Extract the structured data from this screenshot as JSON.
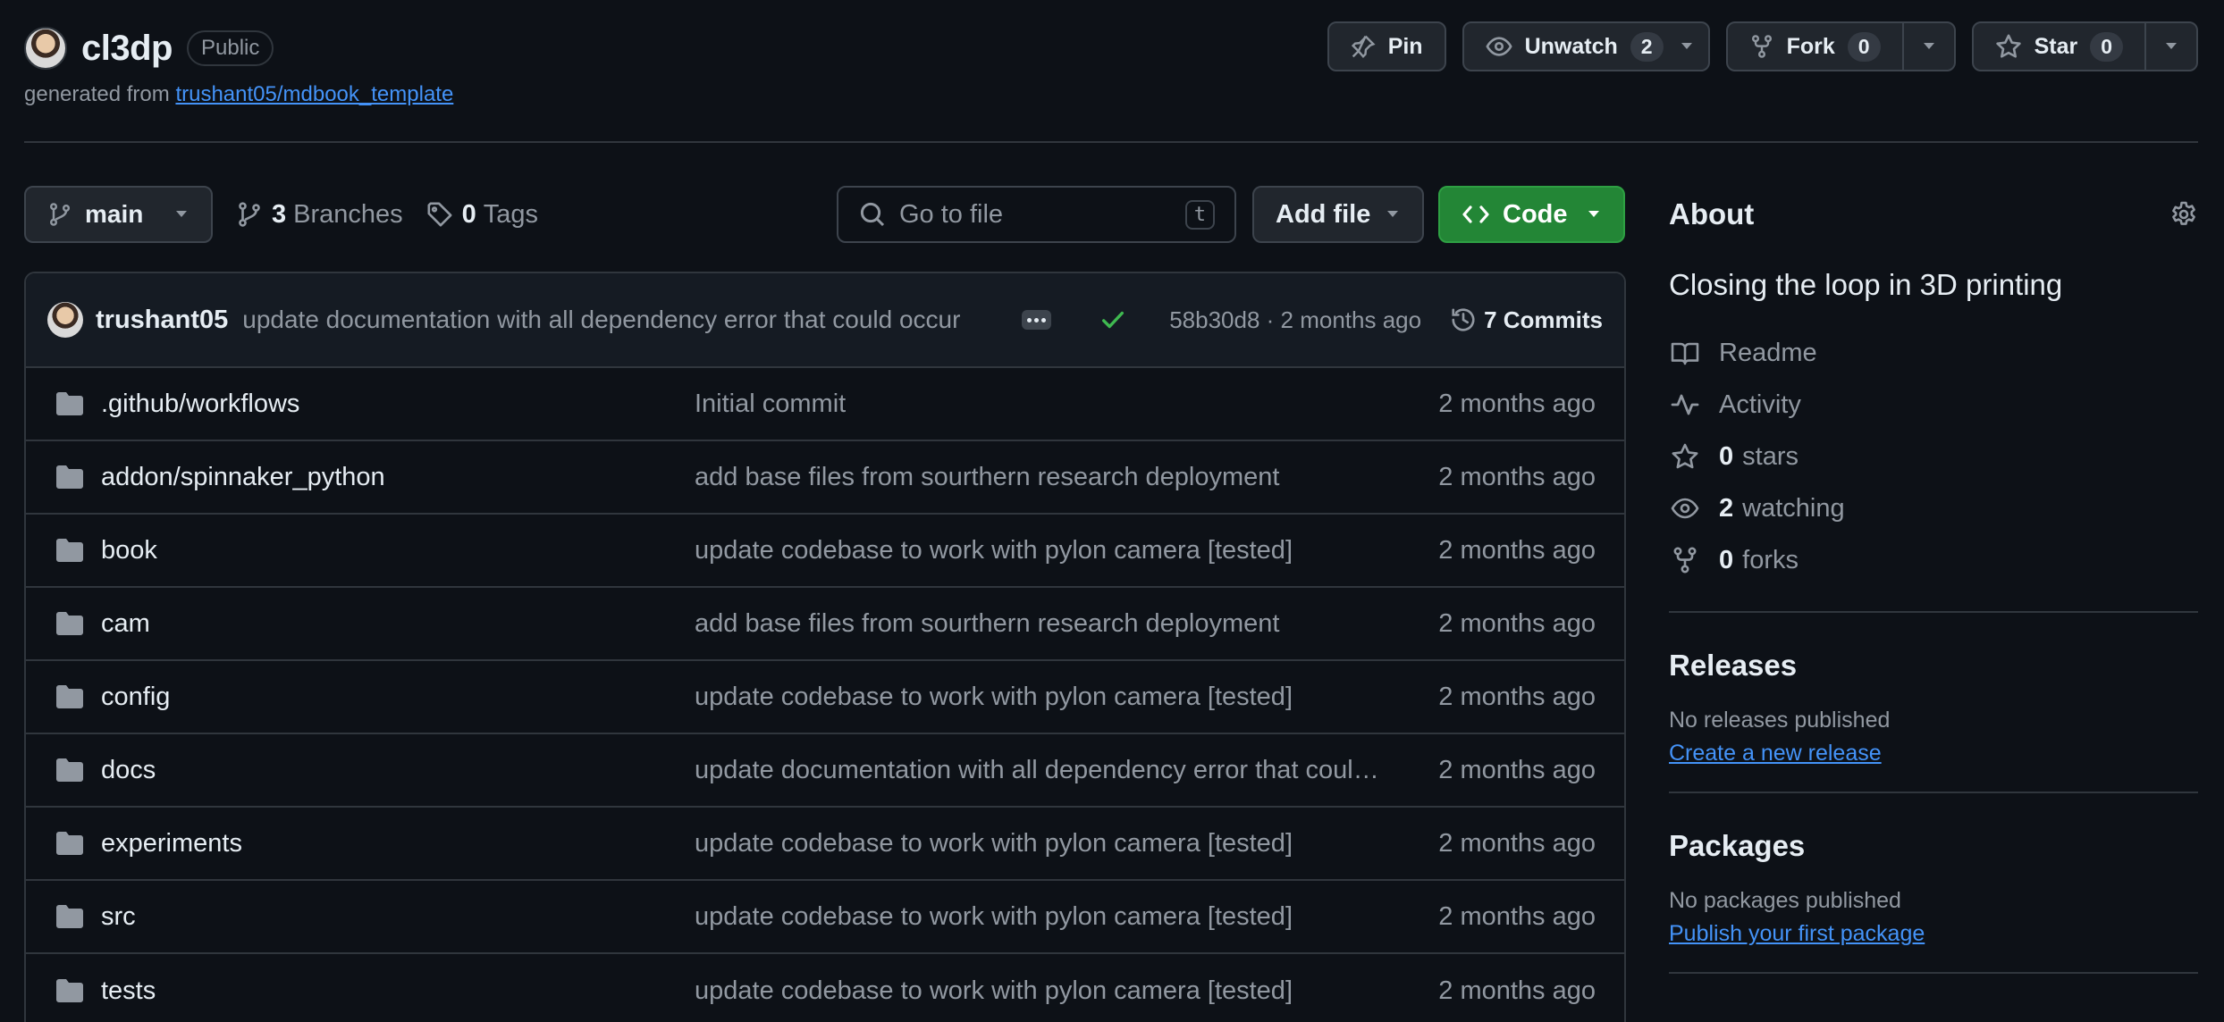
{
  "repo": {
    "name": "cl3dp",
    "visibility": "Public",
    "generated_prefix": "generated from",
    "template_link": "trushant05/mdbook_template"
  },
  "actions": {
    "pin": "Pin",
    "unwatch": "Unwatch",
    "watch_count": "2",
    "fork": "Fork",
    "fork_count": "0",
    "star": "Star",
    "star_count": "0"
  },
  "toolbar": {
    "branch": "main",
    "branches_count": "3",
    "branches_label": "Branches",
    "tags_count": "0",
    "tags_label": "Tags",
    "search_placeholder": "Go to file",
    "search_shortcut": "t",
    "add_file": "Add file",
    "code": "Code"
  },
  "latest_commit": {
    "author": "trushant05",
    "message": "update documentation with all dependency error that could occur",
    "sha_time": "58b30d8 · 2 months ago",
    "commits_label": "7 Commits"
  },
  "files": [
    {
      "name": ".github/workflows",
      "message": "Initial commit",
      "date": "2 months ago"
    },
    {
      "name": "addon/spinnaker_python",
      "message": "add base files from sourthern research deployment",
      "date": "2 months ago"
    },
    {
      "name": "book",
      "message": "update codebase to work with pylon camera [tested]",
      "date": "2 months ago"
    },
    {
      "name": "cam",
      "message": "add base files from sourthern research deployment",
      "date": "2 months ago"
    },
    {
      "name": "config",
      "message": "update codebase to work with pylon camera [tested]",
      "date": "2 months ago"
    },
    {
      "name": "docs",
      "message": "update documentation with all dependency error that could occur",
      "date": "2 months ago"
    },
    {
      "name": "experiments",
      "message": "update codebase to work with pylon camera [tested]",
      "date": "2 months ago"
    },
    {
      "name": "src",
      "message": "update codebase to work with pylon camera [tested]",
      "date": "2 months ago"
    },
    {
      "name": "tests",
      "message": "update codebase to work with pylon camera [tested]",
      "date": "2 months ago"
    }
  ],
  "about": {
    "title": "About",
    "description": "Closing the loop in 3D printing",
    "readme": "Readme",
    "activity": "Activity",
    "stars_count": "0",
    "stars_label": "stars",
    "watching_count": "2",
    "watching_label": "watching",
    "forks_count": "0",
    "forks_label": "forks"
  },
  "releases": {
    "title": "Releases",
    "note": "No releases published",
    "link": "Create a new release"
  },
  "packages": {
    "title": "Packages",
    "note": "No packages published",
    "link": "Publish your first package"
  },
  "colors": {
    "background": "#0d1117",
    "border": "#30363d",
    "link": "#4493f8",
    "code_button": "#238636",
    "muted_text": "#9198a1"
  }
}
